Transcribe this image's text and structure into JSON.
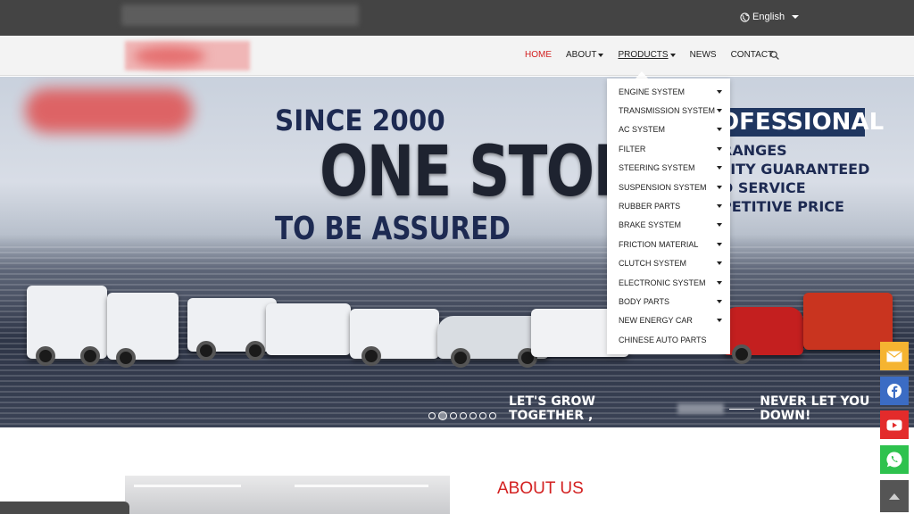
{
  "topbar": {
    "language": "English"
  },
  "nav": {
    "items": [
      {
        "label": "HOME"
      },
      {
        "label": "ABOUT"
      },
      {
        "label": "PRODUCTS"
      },
      {
        "label": "NEWS"
      },
      {
        "label": "CONTACT"
      }
    ]
  },
  "products_menu": [
    "ENGINE SYSTEM",
    "TRANSMISSION SYSTEM",
    "AC SYSTEM",
    "FILTER",
    "STEERING SYSTEM",
    "SUSPENSION SYSTEM",
    "RUBBER PARTS",
    "BRAKE SYSTEM",
    "FRICTION MATERIAL",
    "CLUTCH SYSTEM",
    "ELECTRONIC SYSTEM",
    "BODY PARTS",
    "NEW ENERGY CAR",
    "CHINESE AUTO PARTS"
  ],
  "hero": {
    "line1": "SINCE 2000",
    "line2": "ONE STOP",
    "line3": "TO BE ASSURED",
    "badge": "OFESSIONAL",
    "claims": [
      "RANGES",
      "LITY GUARANTEED",
      "D SERVICE",
      "PETITIVE PRICE"
    ],
    "slogan_left": "LET'S GROW TOGETHER ,",
    "slogan_right": "NEVER LET YOU DOWN!",
    "slide_count": 7
  },
  "about": {
    "title": "ABOUT US"
  },
  "colors": {
    "accent": "#d32020",
    "topbar": "#444444"
  },
  "icons": [
    "globe-icon",
    "search-icon",
    "mail-icon",
    "facebook-icon",
    "youtube-icon",
    "whatsapp-icon",
    "back-to-top-icon"
  ]
}
